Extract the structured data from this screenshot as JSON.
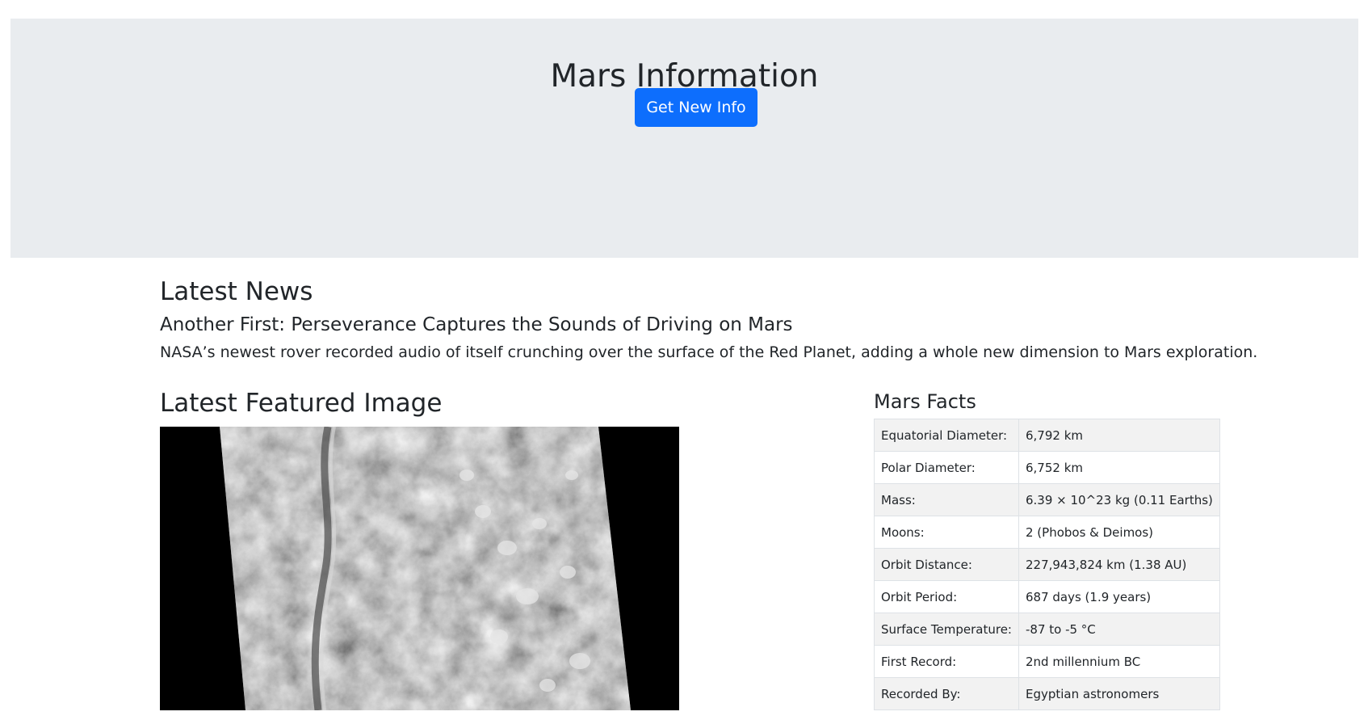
{
  "header": {
    "title": "Mars Information",
    "button_label": "Get New Info"
  },
  "news": {
    "heading": "Latest News",
    "title": "Another First: Perseverance Captures the Sounds of Driving on Mars",
    "teaser": "NASA’s newest rover recorded audio of itself crunching over the surface of the Red Planet, adding a whole new dimension to Mars exploration."
  },
  "featured": {
    "heading": "Latest Featured Image"
  },
  "facts": {
    "heading": "Mars Facts",
    "rows": [
      {
        "label": "Equatorial Diameter:",
        "value": "6,792 km"
      },
      {
        "label": "Polar Diameter:",
        "value": "6,752 km"
      },
      {
        "label": "Mass:",
        "value": "6.39 × 10^23 kg (0.11 Earths)"
      },
      {
        "label": "Moons:",
        "value": "2 (Phobos & Deimos)"
      },
      {
        "label": "Orbit Distance:",
        "value": "227,943,824 km (1.38 AU)"
      },
      {
        "label": "Orbit Period:",
        "value": "687 days (1.9 years)"
      },
      {
        "label": "Surface Temperature:",
        "value": "-87 to -5 °C"
      },
      {
        "label": "First Record:",
        "value": "2nd millennium BC"
      },
      {
        "label": "Recorded By:",
        "value": "Egyptian astronomers"
      }
    ]
  },
  "colors": {
    "jumbotron_bg": "#e9ecef",
    "primary": "#0d6efd",
    "text": "#212529",
    "table_stripe": "#f2f2f2"
  }
}
